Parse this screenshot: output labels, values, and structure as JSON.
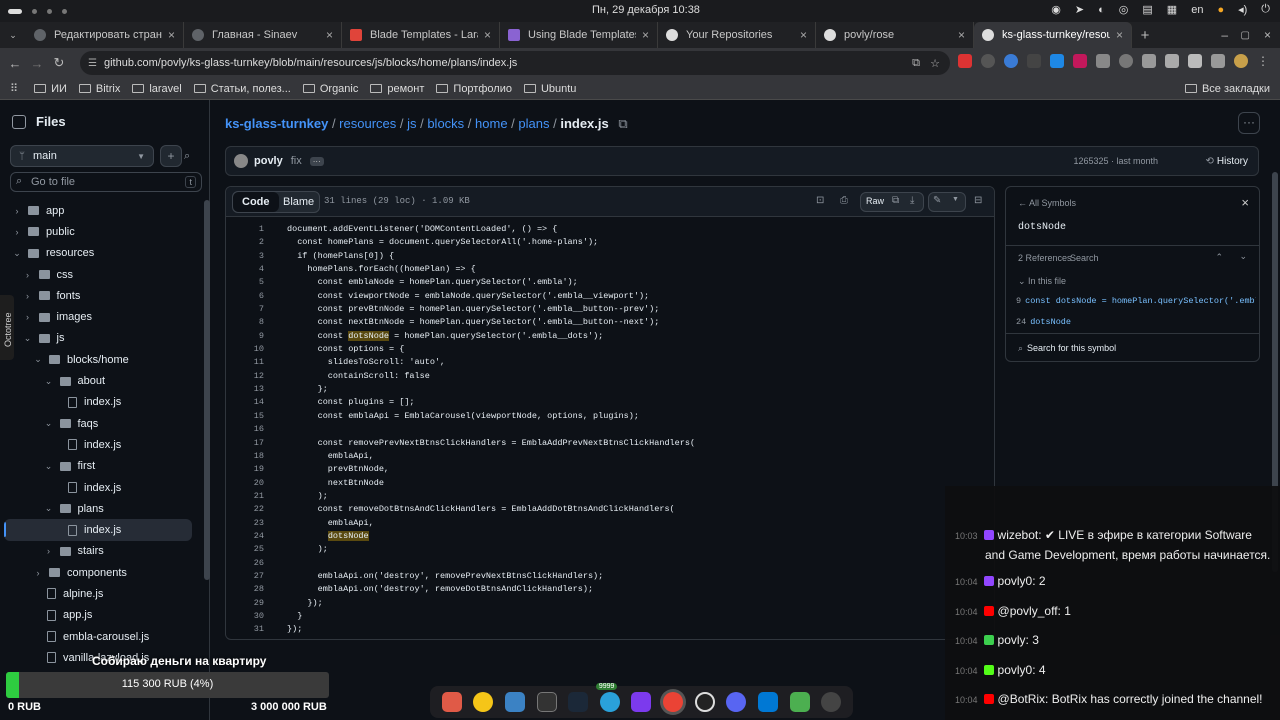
{
  "system": {
    "clock": "Пн, 29 декабря  10:38",
    "lang": "en"
  },
  "tabs": [
    {
      "label": "Редактировать страниц"
    },
    {
      "label": "Главная - Sinaev"
    },
    {
      "label": "Blade Templates - Larave"
    },
    {
      "label": "Using Blade Templates i"
    },
    {
      "label": "Your Repositories"
    },
    {
      "label": "povly/rose"
    },
    {
      "label": "ks-glass-turnkey/resourc"
    }
  ],
  "url": "github.com/povly/ks-glass-turnkey/blob/main/resources/js/blocks/home/plans/index.js",
  "bookmarks": [
    "ИИ",
    "Bitrix",
    "laravel",
    "Статьи, полез...",
    "Organic",
    "ремонт",
    "Портфолио",
    "Ubuntu"
  ],
  "bookmarks_all": "Все закладки",
  "sidebar": {
    "title": "Files",
    "branch": "main",
    "goto_placeholder": "Go to file",
    "goto_kbd": "t",
    "tree": [
      {
        "label": "app",
        "type": "folder",
        "depth": 0,
        "open": false
      },
      {
        "label": "public",
        "type": "folder",
        "depth": 0,
        "open": false
      },
      {
        "label": "resources",
        "type": "folder",
        "depth": 0,
        "open": true
      },
      {
        "label": "css",
        "type": "folder",
        "depth": 1,
        "open": false
      },
      {
        "label": "fonts",
        "type": "folder",
        "depth": 1,
        "open": false
      },
      {
        "label": "images",
        "type": "folder",
        "depth": 1,
        "open": false
      },
      {
        "label": "js",
        "type": "folder",
        "depth": 1,
        "open": true
      },
      {
        "label": "blocks/home",
        "type": "folder",
        "depth": 2,
        "open": true
      },
      {
        "label": "about",
        "type": "folder",
        "depth": 3,
        "open": true
      },
      {
        "label": "index.js",
        "type": "file",
        "depth": 4
      },
      {
        "label": "faqs",
        "type": "folder",
        "depth": 3,
        "open": true
      },
      {
        "label": "index.js",
        "type": "file",
        "depth": 4
      },
      {
        "label": "first",
        "type": "folder",
        "depth": 3,
        "open": true
      },
      {
        "label": "index.js",
        "type": "file",
        "depth": 4
      },
      {
        "label": "plans",
        "type": "folder",
        "depth": 3,
        "open": true
      },
      {
        "label": "index.js",
        "type": "file",
        "depth": 4,
        "selected": true
      },
      {
        "label": "stairs",
        "type": "folder",
        "depth": 3,
        "open": false
      },
      {
        "label": "components",
        "type": "folder",
        "depth": 2,
        "open": false
      },
      {
        "label": "alpine.js",
        "type": "file",
        "depth": 2
      },
      {
        "label": "app.js",
        "type": "file",
        "depth": 2
      },
      {
        "label": "embla-carousel.js",
        "type": "file",
        "depth": 2
      },
      {
        "label": "vanilla-lazyload.js",
        "type": "file",
        "depth": 2
      }
    ],
    "octotree_label": "Octotree"
  },
  "breadcrumb": {
    "repo": "ks-glass-turnkey",
    "parts": [
      "resources",
      "js",
      "blocks",
      "home",
      "plans"
    ],
    "file": "index.js"
  },
  "commit": {
    "author": "povly",
    "message": "fix",
    "hash_time": "1265325 · last month",
    "history": "History"
  },
  "viewer": {
    "code_tab": "Code",
    "blame_tab": "Blame",
    "meta": "31 lines (29 loc) · 1.09 KB",
    "raw": "Raw"
  },
  "code": [
    "document.addEventListener('DOMContentLoaded', () => {",
    "  const homePlans = document.querySelectorAll('.home-plans');",
    "  if (homePlans[0]) {",
    "    homePlans.forEach((homePlan) => {",
    "      const emblaNode = homePlan.querySelector('.embla');",
    "      const viewportNode = emblaNode.querySelector('.embla__viewport');",
    "      const prevBtnNode = homePlan.querySelector('.embla__button--prev');",
    "      const nextBtnNode = homePlan.querySelector('.embla__button--next');",
    "      const dotsNode = homePlan.querySelector('.embla__dots');",
    "      const options = {",
    "        slidesToScroll: 'auto',",
    "        containScroll: false",
    "      };",
    "      const plugins = [];",
    "      const emblaApi = EmblaCarousel(viewportNode, options, plugins);",
    "",
    "      const removePrevNextBtnsClickHandlers = EmblaAddPrevNextBtnsClickHandlers(",
    "        emblaApi,",
    "        prevBtnNode,",
    "        nextBtnNode",
    "      );",
    "      const removeDotBtnsAndClickHandlers = EmblaAddDotBtnsAndClickHandlers(",
    "        emblaApi,",
    "        dotsNode",
    "      );",
    "",
    "      emblaApi.on('destroy', removePrevNextBtnsClickHandlers);",
    "      emblaApi.on('destroy', removeDotBtnsAndClickHandlers);",
    "    });",
    "  }",
    "});"
  ],
  "symbols": {
    "back": "All Symbols",
    "symbol": "dotsNode",
    "refs": "2 References",
    "search_tab": "Search",
    "in_file": "In this file",
    "results": [
      {
        "line": "9",
        "text": "const dotsNode = homePlan.querySelector('.embla__"
      },
      {
        "line": "24",
        "text": "dotsNode"
      }
    ],
    "search_for": "Search for this symbol"
  },
  "chat": [
    {
      "time": "10:03",
      "user": "wizebot:",
      "text": "✔ LIVE в эфире в категории Software",
      "text2": "and Game Development, время работы начинается."
    },
    {
      "time": "10:04",
      "user": "povly0:",
      "text": "2"
    },
    {
      "time": "10:04",
      "user": "@povly_off:",
      "text": "1"
    },
    {
      "time": "10:04",
      "user": "povly:",
      "text": "3"
    },
    {
      "time": "10:04",
      "user": "povly0:",
      "text": "4"
    },
    {
      "time": "10:04",
      "user": "@BotRix:",
      "text": "BotRix has correctly joined the channel!"
    }
  ],
  "donation": {
    "title": "Собираю деньги на квартиру",
    "progress_label": "115 300 RUB (4%)",
    "progress": 0.04,
    "min": "0 RUB",
    "max": "3 000 000 RUB"
  },
  "dock_badge": "9999"
}
